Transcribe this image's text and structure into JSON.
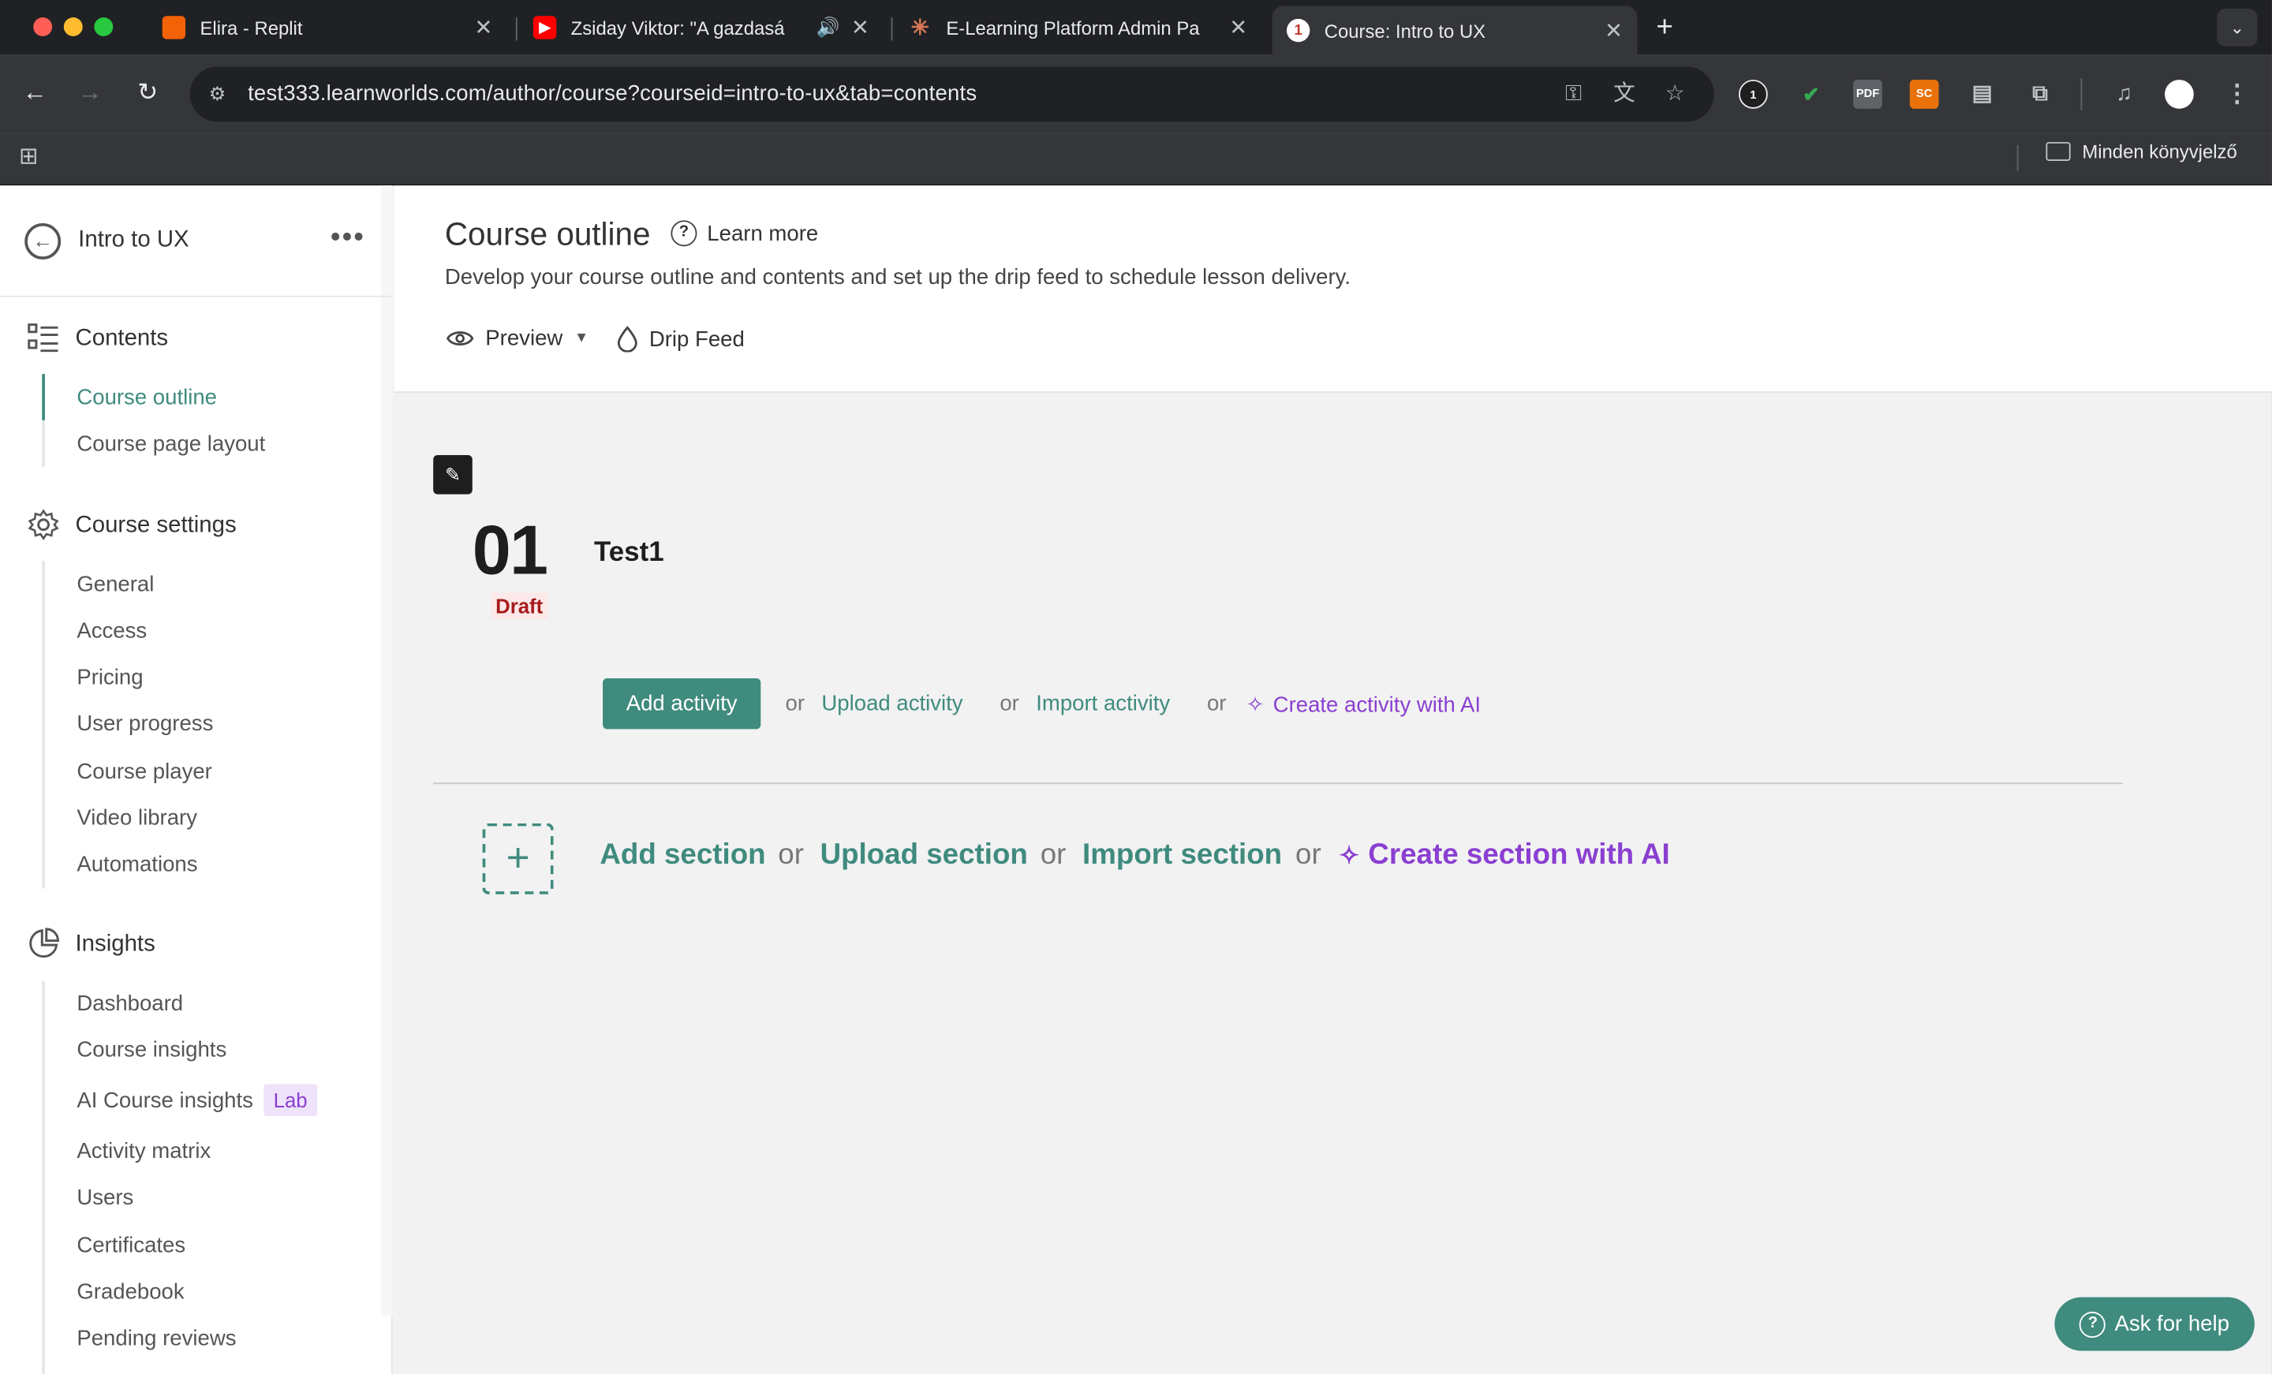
{
  "browser": {
    "tabs": [
      {
        "title": "Elira - Replit",
        "fav_color": "#f26207"
      },
      {
        "title": "Zsiday Viktor: \"A gazdasá",
        "fav_color": "#ff0000"
      },
      {
        "title": "E-Learning Platform Admin Pa",
        "fav_color": "#d97757"
      },
      {
        "title": "Course: Intro to UX",
        "fav_color": "#c0392b"
      }
    ],
    "url": "test333.learnworlds.com/author/course?courseid=intro-to-ux&tab=contents",
    "bookmark_folder": "Minden könyvjelző",
    "ext_badge": "1",
    "ext_pdf": "PDF",
    "ext_sc": "SC"
  },
  "sidebar": {
    "course_name": "Intro to UX",
    "contents": {
      "title": "Contents",
      "items": [
        "Course outline",
        "Course page layout"
      ]
    },
    "settings": {
      "title": "Course settings",
      "items": [
        "General",
        "Access",
        "Pricing",
        "User progress",
        "Course player",
        "Video library",
        "Automations"
      ]
    },
    "insights": {
      "title": "Insights",
      "items": [
        "Dashboard",
        "Course insights",
        "AI Course insights",
        "Activity matrix",
        "Users",
        "Certificates",
        "Gradebook",
        "Pending reviews"
      ],
      "lab_badge": "Lab"
    }
  },
  "header": {
    "title": "Course outline",
    "learn_more": "Learn more",
    "subtitle": "Develop your course outline and contents and set up the drip feed to schedule lesson delivery.",
    "preview": "Preview",
    "drip_feed": "Drip Feed"
  },
  "section": {
    "number": "01",
    "status": "Draft",
    "name": "Test1",
    "add_activity": "Add activity",
    "or": "or",
    "upload_activity": "Upload activity",
    "import_activity": "Import activity",
    "ai_activity": "Create activity with AI"
  },
  "add_section": {
    "add": "Add section",
    "upload": "Upload section",
    "import": "Import section",
    "ai": "Create section with AI"
  },
  "help": {
    "label": "Ask for help"
  }
}
